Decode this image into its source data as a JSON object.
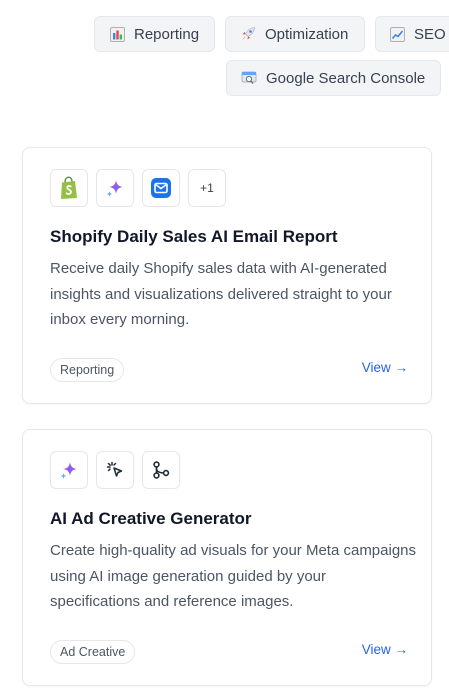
{
  "category_chips": [
    {
      "label": "Reporting",
      "icon": "bar-chart-icon"
    },
    {
      "label": "Optimization",
      "icon": "rocket-icon"
    },
    {
      "label": "SEO",
      "icon": "trend-chart-icon"
    },
    {
      "label": "Google Search Console",
      "icon": "search-console-icon"
    }
  ],
  "cards": [
    {
      "icons": [
        "shopify-icon",
        "ai-sparkle-icon",
        "email-icon"
      ],
      "more_count": "+1",
      "title": "Shopify Daily Sales AI Email Report",
      "description": "Receive daily Shopify sales data with AI-generated insights and visualizations delivered straight to your inbox every morning.",
      "tag": "Reporting",
      "view_label": "View →"
    },
    {
      "icons": [
        "ai-sparkle-icon",
        "cursor-click-icon",
        "workflow-icon"
      ],
      "title": "AI Ad Creative Generator",
      "description": "Create high-quality ad visuals for your Meta campaigns using AI image generation guided by your specifications and reference images.",
      "tag": "Ad Creative",
      "view_label": "View →"
    }
  ],
  "colors": {
    "link": "#2563eb",
    "shopify_green": "#95bf47",
    "email_blue": "#1a73e8"
  }
}
